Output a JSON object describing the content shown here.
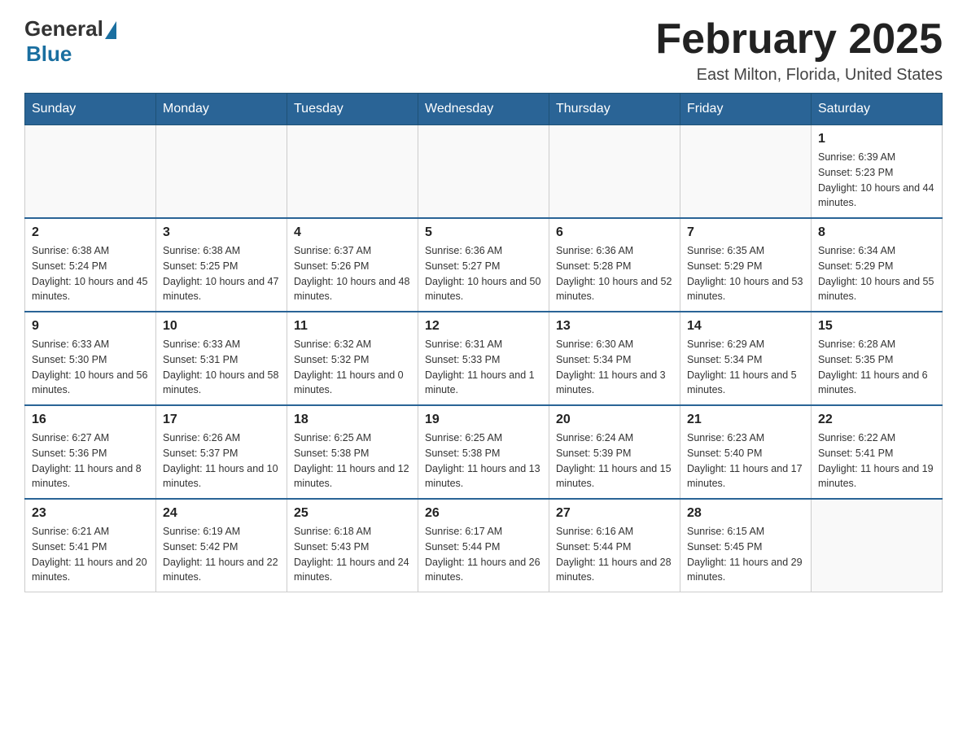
{
  "logo": {
    "general": "General",
    "blue": "Blue"
  },
  "title": "February 2025",
  "location": "East Milton, Florida, United States",
  "days_of_week": [
    "Sunday",
    "Monday",
    "Tuesday",
    "Wednesday",
    "Thursday",
    "Friday",
    "Saturday"
  ],
  "weeks": [
    [
      {
        "day": "",
        "info": ""
      },
      {
        "day": "",
        "info": ""
      },
      {
        "day": "",
        "info": ""
      },
      {
        "day": "",
        "info": ""
      },
      {
        "day": "",
        "info": ""
      },
      {
        "day": "",
        "info": ""
      },
      {
        "day": "1",
        "info": "Sunrise: 6:39 AM\nSunset: 5:23 PM\nDaylight: 10 hours and 44 minutes."
      }
    ],
    [
      {
        "day": "2",
        "info": "Sunrise: 6:38 AM\nSunset: 5:24 PM\nDaylight: 10 hours and 45 minutes."
      },
      {
        "day": "3",
        "info": "Sunrise: 6:38 AM\nSunset: 5:25 PM\nDaylight: 10 hours and 47 minutes."
      },
      {
        "day": "4",
        "info": "Sunrise: 6:37 AM\nSunset: 5:26 PM\nDaylight: 10 hours and 48 minutes."
      },
      {
        "day": "5",
        "info": "Sunrise: 6:36 AM\nSunset: 5:27 PM\nDaylight: 10 hours and 50 minutes."
      },
      {
        "day": "6",
        "info": "Sunrise: 6:36 AM\nSunset: 5:28 PM\nDaylight: 10 hours and 52 minutes."
      },
      {
        "day": "7",
        "info": "Sunrise: 6:35 AM\nSunset: 5:29 PM\nDaylight: 10 hours and 53 minutes."
      },
      {
        "day": "8",
        "info": "Sunrise: 6:34 AM\nSunset: 5:29 PM\nDaylight: 10 hours and 55 minutes."
      }
    ],
    [
      {
        "day": "9",
        "info": "Sunrise: 6:33 AM\nSunset: 5:30 PM\nDaylight: 10 hours and 56 minutes."
      },
      {
        "day": "10",
        "info": "Sunrise: 6:33 AM\nSunset: 5:31 PM\nDaylight: 10 hours and 58 minutes."
      },
      {
        "day": "11",
        "info": "Sunrise: 6:32 AM\nSunset: 5:32 PM\nDaylight: 11 hours and 0 minutes."
      },
      {
        "day": "12",
        "info": "Sunrise: 6:31 AM\nSunset: 5:33 PM\nDaylight: 11 hours and 1 minute."
      },
      {
        "day": "13",
        "info": "Sunrise: 6:30 AM\nSunset: 5:34 PM\nDaylight: 11 hours and 3 minutes."
      },
      {
        "day": "14",
        "info": "Sunrise: 6:29 AM\nSunset: 5:34 PM\nDaylight: 11 hours and 5 minutes."
      },
      {
        "day": "15",
        "info": "Sunrise: 6:28 AM\nSunset: 5:35 PM\nDaylight: 11 hours and 6 minutes."
      }
    ],
    [
      {
        "day": "16",
        "info": "Sunrise: 6:27 AM\nSunset: 5:36 PM\nDaylight: 11 hours and 8 minutes."
      },
      {
        "day": "17",
        "info": "Sunrise: 6:26 AM\nSunset: 5:37 PM\nDaylight: 11 hours and 10 minutes."
      },
      {
        "day": "18",
        "info": "Sunrise: 6:25 AM\nSunset: 5:38 PM\nDaylight: 11 hours and 12 minutes."
      },
      {
        "day": "19",
        "info": "Sunrise: 6:25 AM\nSunset: 5:38 PM\nDaylight: 11 hours and 13 minutes."
      },
      {
        "day": "20",
        "info": "Sunrise: 6:24 AM\nSunset: 5:39 PM\nDaylight: 11 hours and 15 minutes."
      },
      {
        "day": "21",
        "info": "Sunrise: 6:23 AM\nSunset: 5:40 PM\nDaylight: 11 hours and 17 minutes."
      },
      {
        "day": "22",
        "info": "Sunrise: 6:22 AM\nSunset: 5:41 PM\nDaylight: 11 hours and 19 minutes."
      }
    ],
    [
      {
        "day": "23",
        "info": "Sunrise: 6:21 AM\nSunset: 5:41 PM\nDaylight: 11 hours and 20 minutes."
      },
      {
        "day": "24",
        "info": "Sunrise: 6:19 AM\nSunset: 5:42 PM\nDaylight: 11 hours and 22 minutes."
      },
      {
        "day": "25",
        "info": "Sunrise: 6:18 AM\nSunset: 5:43 PM\nDaylight: 11 hours and 24 minutes."
      },
      {
        "day": "26",
        "info": "Sunrise: 6:17 AM\nSunset: 5:44 PM\nDaylight: 11 hours and 26 minutes."
      },
      {
        "day": "27",
        "info": "Sunrise: 6:16 AM\nSunset: 5:44 PM\nDaylight: 11 hours and 28 minutes."
      },
      {
        "day": "28",
        "info": "Sunrise: 6:15 AM\nSunset: 5:45 PM\nDaylight: 11 hours and 29 minutes."
      },
      {
        "day": "",
        "info": ""
      }
    ]
  ]
}
